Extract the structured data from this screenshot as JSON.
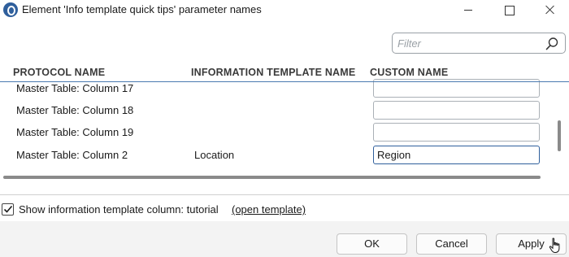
{
  "window": {
    "title": "Element 'Info template quick tips' parameter names",
    "icon": "app-logo-icon"
  },
  "filter": {
    "placeholder": "Filter",
    "value": ""
  },
  "table": {
    "headers": {
      "protocol": "PROTOCOL NAME",
      "info": "INFORMATION TEMPLATE NAME",
      "custom": "CUSTOM NAME"
    },
    "rows": [
      {
        "protocol": "Master Table: Column 17",
        "info": "",
        "custom": ""
      },
      {
        "protocol": "Master Table: Column 18",
        "info": "",
        "custom": ""
      },
      {
        "protocol": "Master Table: Column 19",
        "info": "",
        "custom": ""
      },
      {
        "protocol": "Master Table: Column 2",
        "info": "Location",
        "custom": "Region"
      }
    ]
  },
  "options": {
    "show_info_column_label": "Show information template column: tutorial",
    "show_info_column_checked": true,
    "open_template_link": "(open template)"
  },
  "buttons": {
    "ok": "OK",
    "cancel": "Cancel",
    "apply": "Apply"
  },
  "colors": {
    "accent": "#2f5f9c",
    "header_rule": "#4a7ab0"
  }
}
